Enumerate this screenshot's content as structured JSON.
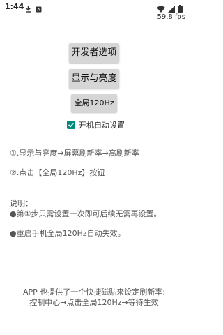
{
  "status_bar": {
    "time": "1:44",
    "icons_left": [
      "download-icon",
      "app-notification-icon"
    ],
    "icons_right": [
      "wifi-icon",
      "signal-icon",
      "battery-icon"
    ]
  },
  "fps_overlay": "59.8 fps",
  "buttons": {
    "developer_options": "开发者选项",
    "display_brightness": "显示与亮度",
    "global_120hz": "全局120Hz"
  },
  "checkbox": {
    "label": "开机自动设置",
    "checked": true,
    "color": "#00897b"
  },
  "instructions": {
    "step1": "①.显示与亮度→屏幕刷新率→高刷新率",
    "step2": "②.点击【全局120Hz】按钮"
  },
  "notes": {
    "title": "说明：",
    "note1": "●第①步只需设置一次即可后续无需再设置。",
    "note2": "●重启手机全局120Hz自动失效。"
  },
  "footer": {
    "line1": "APP 也提供了一个快捷磁贴来设定刷新率:",
    "line2": "控制中心→点击全局120Hz→等待生效"
  }
}
